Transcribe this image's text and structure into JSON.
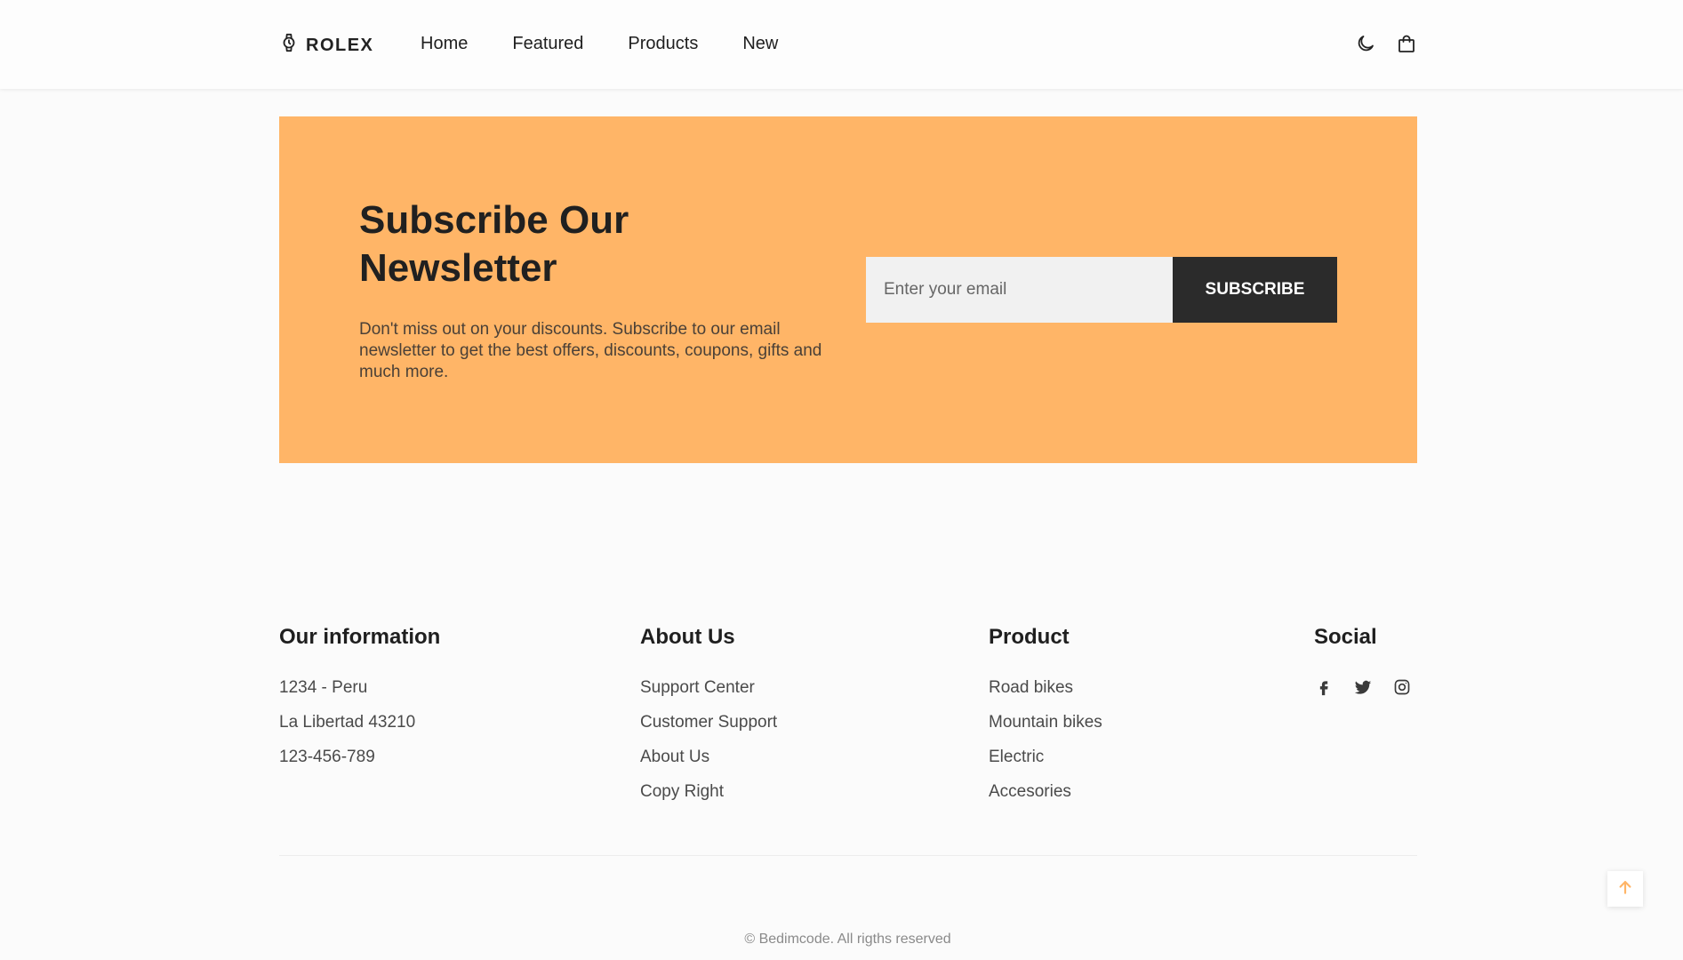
{
  "header": {
    "logo_text": "ROLEX",
    "logo_icon": "watch-icon",
    "nav": [
      {
        "label": "Home"
      },
      {
        "label": "Featured"
      },
      {
        "label": "Products"
      },
      {
        "label": "New"
      }
    ],
    "icons": [
      "moon-icon",
      "shopping-bag-icon"
    ]
  },
  "newsletter": {
    "title": "Subscribe Our Newsletter",
    "description": "Don't miss out on your discounts. Subscribe to our email newsletter to get the best offers, discounts, coupons, gifts and much more.",
    "email_placeholder": "Enter your email",
    "button_label": "SUBSCRIBE",
    "background_color": "#ffb567"
  },
  "footer": {
    "info": {
      "title": "Our information",
      "lines": [
        "1234 - Peru",
        "La Libertad 43210",
        "123-456-789"
      ]
    },
    "about": {
      "title": "About Us",
      "links": [
        "Support Center",
        "Customer Support",
        "About Us",
        "Copy Right"
      ]
    },
    "product": {
      "title": "Product",
      "links": [
        "Road bikes",
        "Mountain bikes",
        "Electric",
        "Accesories"
      ]
    },
    "social": {
      "title": "Social",
      "icons": [
        "facebook-icon",
        "twitter-icon",
        "instagram-icon"
      ]
    },
    "copyright": "© Bedimcode. All rigths reserved"
  },
  "scroll_top": {
    "icon": "arrow-up-icon",
    "color": "#ffb567"
  }
}
